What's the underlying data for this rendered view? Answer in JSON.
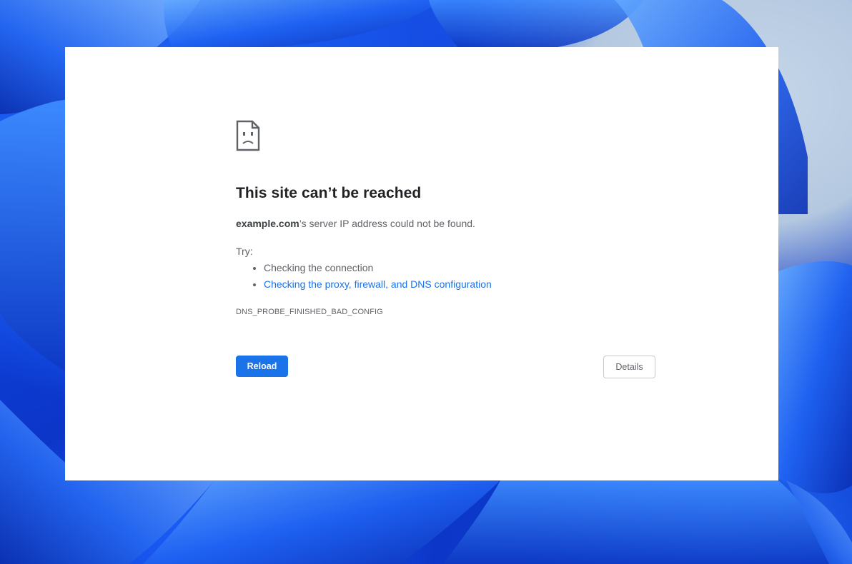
{
  "error_page": {
    "icon": "sad-page-icon",
    "title": "This site can’t be reached",
    "description": {
      "host": "example.com",
      "message": "’s server IP address could not be found."
    },
    "try_label": "Try:",
    "suggestions": [
      {
        "label": "Checking the connection",
        "is_link": false
      },
      {
        "label": "Checking the proxy, firewall, and DNS configuration",
        "is_link": true
      }
    ],
    "error_code": "DNS_PROBE_FINISHED_BAD_CONFIG",
    "buttons": {
      "reload": "Reload",
      "details": "Details"
    }
  },
  "colors": {
    "accent": "#1a73e8",
    "title_text": "#202124",
    "body_text": "#5f6368",
    "window_bg": "#ffffff"
  }
}
